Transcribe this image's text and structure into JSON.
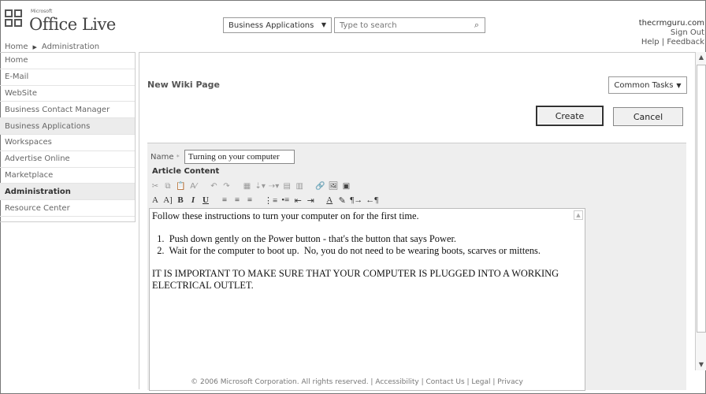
{
  "header": {
    "brand_small": "Microsoft",
    "brand": "Office Live",
    "breadcrumb": [
      "Home",
      "Administration"
    ],
    "biz_select": "Business Applications",
    "search_placeholder": "Type to search",
    "user": "thecrmguru.com",
    "sign_out": "Sign Out",
    "help": "Help",
    "feedback": "Feedback"
  },
  "sidebar": {
    "items": [
      {
        "label": "Home"
      },
      {
        "label": "E-Mail"
      },
      {
        "label": "WebSite"
      },
      {
        "label": "Business Contact Manager"
      },
      {
        "label": "Business Applications"
      },
      {
        "label": "Workspaces"
      },
      {
        "label": "Advertise Online"
      },
      {
        "label": "Marketplace"
      },
      {
        "label": "Administration"
      },
      {
        "label": "Resource Center"
      }
    ]
  },
  "main": {
    "title": "New Wiki Page",
    "common_tasks": "Common Tasks",
    "create": "Create",
    "cancel": "Cancel",
    "name_label": "Name",
    "name_required": "*",
    "name_value": "Turning on your computer",
    "article_label": "Article Content",
    "content": "Follow these instructions to turn your computer on for the first time.\n\n  1.  Push down gently on the Power button - that's the button that says Power.\n  2.  Wait for the computer to boot up.  No, you do not need to be wearing boots, scarves or mittens.\n\nIT IS IMPORTANT TO MAKE SURE THAT YOUR COMPUTER IS PLUGGED INTO A WORKING ELECTRICAL OUTLET."
  },
  "toolbar1": [
    "cut-icon",
    "copy-icon",
    "paste-icon",
    "spell-icon",
    "undo-icon",
    "redo-icon",
    "table-icon",
    "insert-row-icon",
    "insert-col-icon",
    "merge-icon",
    "split-icon",
    "link-icon",
    "image-icon",
    "embed-icon"
  ],
  "toolbar2": {
    "font_size": "A",
    "font_size2": "A]",
    "bold": "B",
    "italic": "I",
    "underline": "U",
    "color": "A"
  },
  "footer": {
    "copyright": "© 2006 Microsoft Corporation. All rights reserved.",
    "links": [
      "Accessibility",
      "Contact Us",
      "Legal",
      "Privacy"
    ]
  }
}
